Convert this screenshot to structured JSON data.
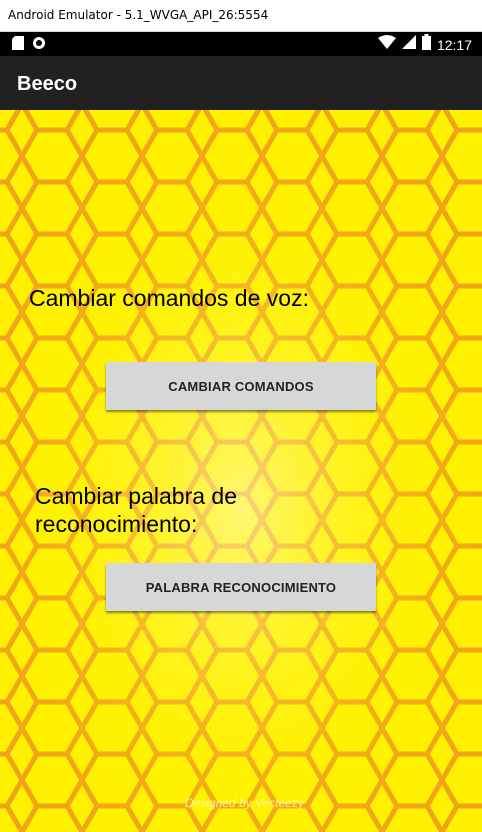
{
  "window": {
    "title": "Android Emulator - 5.1_WVGA_API_26:5554"
  },
  "status_bar": {
    "time": "12:17",
    "icons": [
      "sd-card-icon",
      "record-icon",
      "wifi-icon",
      "signal-icon",
      "battery-icon"
    ]
  },
  "app_bar": {
    "title": "Beeco"
  },
  "main": {
    "voice_commands_label": "Cambiar comandos de voz:",
    "change_commands_button": "CAMBIAR COMANDOS",
    "recognition_word_label_line1": "Cambiar palabra de",
    "recognition_word_label_line2": "reconocimiento:",
    "recognition_word_button": "PALABRA RECONOCIMIENTO"
  },
  "background": {
    "watermark": "Designed by Vecteezy"
  },
  "colors": {
    "honeycomb_fill": "#ffe000",
    "honeycomb_edge": "#f2a21a",
    "button_bg": "#d6d7d7",
    "app_bar": "#212121"
  }
}
